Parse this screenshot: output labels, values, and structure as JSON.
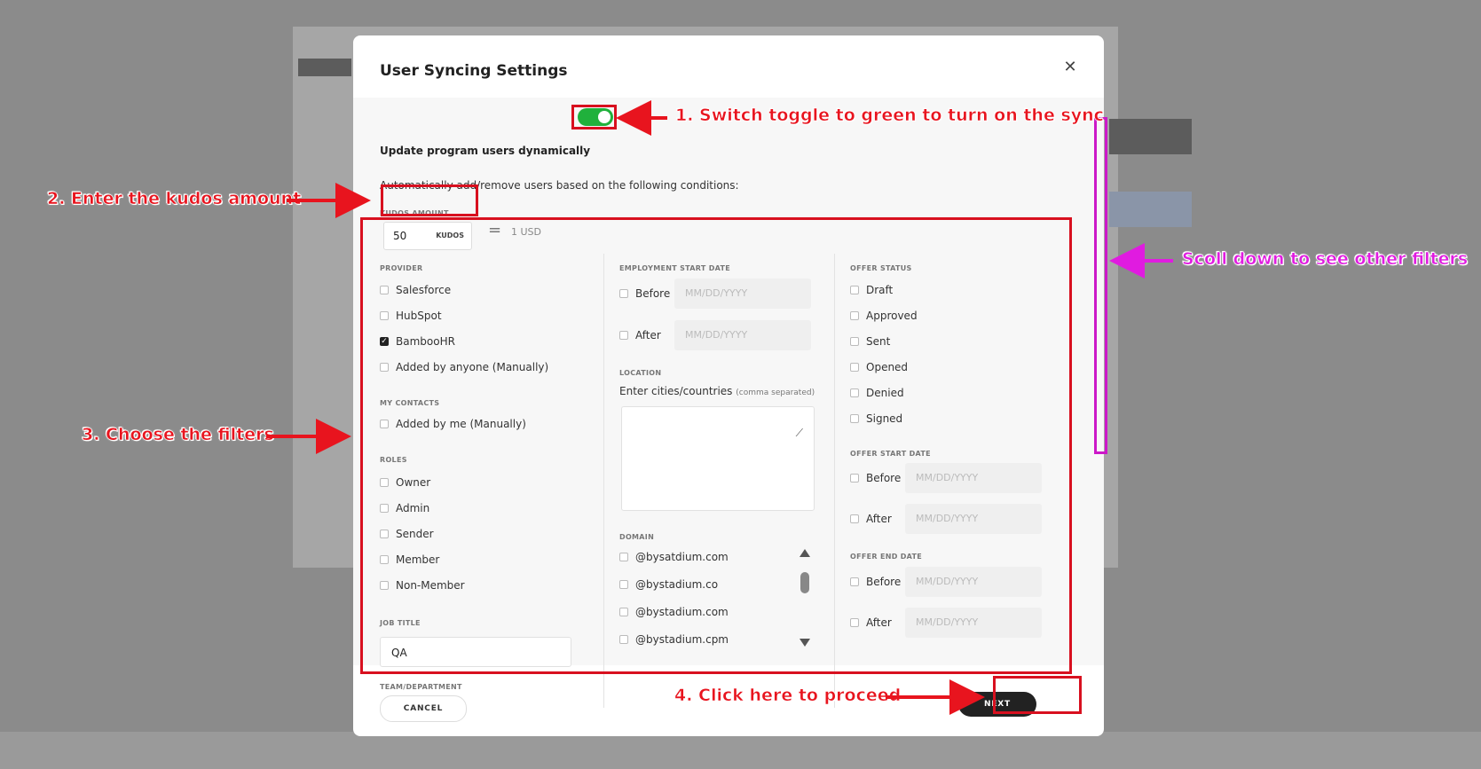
{
  "modal": {
    "title": "User Syncing Settings",
    "close_icon": "close-icon",
    "toggle_label": "Update program users dynamically",
    "toggle_on": true,
    "auto_text": "Automatically add/remove users based on the following conditions:",
    "kudos": {
      "label": "KUDOS AMOUNT",
      "value": "50",
      "unit": "KUDOS",
      "equals": "=",
      "usd": "1 USD"
    },
    "provider": {
      "label": "PROVIDER",
      "items": [
        {
          "label": "Salesforce",
          "checked": false
        },
        {
          "label": "HubSpot",
          "checked": false
        },
        {
          "label": "BambooHR",
          "checked": true
        },
        {
          "label": "Added by anyone (Manually)",
          "checked": false
        }
      ]
    },
    "my_contacts": {
      "label": "MY CONTACTS",
      "items": [
        {
          "label": "Added by me (Manually)",
          "checked": false
        }
      ]
    },
    "roles": {
      "label": "ROLES",
      "items": [
        {
          "label": "Owner",
          "checked": false
        },
        {
          "label": "Admin",
          "checked": false
        },
        {
          "label": "Sender",
          "checked": false
        },
        {
          "label": "Member",
          "checked": false
        },
        {
          "label": "Non-Member",
          "checked": false
        }
      ]
    },
    "job_title": {
      "label": "JOB TITLE",
      "value": "QA"
    },
    "team_department": {
      "label": "TEAM/DEPARTMENT"
    },
    "employment_start_date": {
      "label": "EMPLOYMENT START DATE",
      "before": "Before",
      "after": "After",
      "placeholder": "MM/DD/YYYY"
    },
    "location": {
      "label": "LOCATION",
      "prompt": "Enter cities/countries",
      "hint": "(comma separated)"
    },
    "domain": {
      "label": "DOMAIN",
      "items": [
        {
          "label": "@bysatdium.com",
          "checked": false
        },
        {
          "label": "@bystadium.co",
          "checked": false
        },
        {
          "label": "@bystadium.com",
          "checked": false
        },
        {
          "label": "@bystadium.cpm",
          "checked": false
        }
      ]
    },
    "offer_status": {
      "label": "OFFER STATUS",
      "items": [
        {
          "label": "Draft",
          "checked": false
        },
        {
          "label": "Approved",
          "checked": false
        },
        {
          "label": "Sent",
          "checked": false
        },
        {
          "label": "Opened",
          "checked": false
        },
        {
          "label": "Denied",
          "checked": false
        },
        {
          "label": "Signed",
          "checked": false
        }
      ]
    },
    "offer_start_date": {
      "label": "OFFER START DATE",
      "before": "Before",
      "after": "After",
      "placeholder": "MM/DD/YYYY"
    },
    "offer_end_date": {
      "label": "OFFER END DATE",
      "before": "Before",
      "after": "After",
      "placeholder": "MM/DD/YYYY"
    },
    "cancel_label": "CANCEL",
    "next_label": "NEXT"
  },
  "annotations": {
    "step1": "1. Switch toggle to green to turn on the sync",
    "step2": "2. Enter the kudos amount",
    "step3": "3. Choose the filters",
    "step4": "4. Click here to proceed",
    "scroll": "Scoll down to see other filters",
    "color_red": "#d8101f",
    "color_magenta": "#cc18c8"
  }
}
